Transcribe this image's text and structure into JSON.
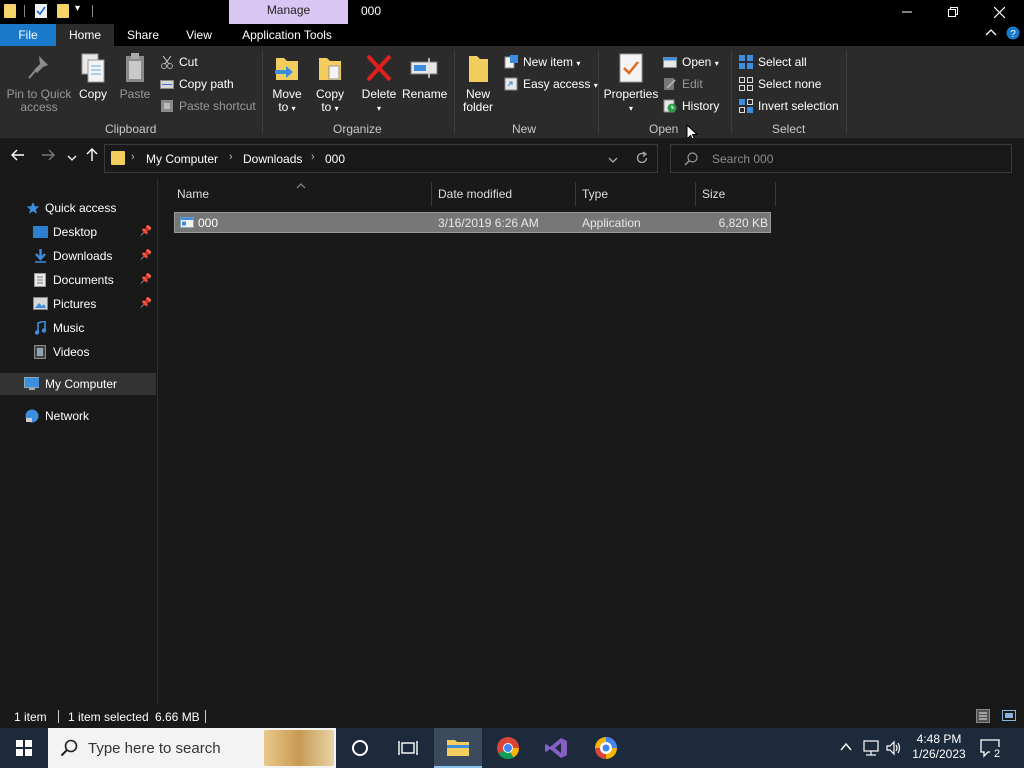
{
  "titlebar": {
    "manage_label": "Manage",
    "title": "000"
  },
  "ribbon_tabs": {
    "file": "File",
    "home": "Home",
    "share": "Share",
    "view": "View",
    "app_tools": "Application Tools"
  },
  "clipboard": {
    "pin": "Pin to Quick access",
    "copy": "Copy",
    "paste": "Paste",
    "cut": "Cut",
    "copy_path": "Copy path",
    "paste_shortcut": "Paste shortcut",
    "label": "Clipboard"
  },
  "organize": {
    "move_to": "Move to",
    "copy_to": "Copy to",
    "delete": "Delete",
    "rename": "Rename",
    "label": "Organize"
  },
  "new_group": {
    "new_folder": "New folder",
    "new_item": "New item",
    "easy_access": "Easy access",
    "label": "New"
  },
  "open_group": {
    "properties": "Properties",
    "open": "Open",
    "edit": "Edit",
    "history": "History",
    "label": "Open"
  },
  "select_group": {
    "select_all": "Select all",
    "select_none": "Select none",
    "invert": "Invert selection",
    "label": "Select"
  },
  "address": {
    "crumbs": [
      "My Computer",
      "Downloads",
      "000"
    ]
  },
  "search": {
    "placeholder": "Search 000"
  },
  "navpane": {
    "quick_access": "Quick access",
    "desktop": "Desktop",
    "downloads": "Downloads",
    "documents": "Documents",
    "pictures": "Pictures",
    "music": "Music",
    "videos": "Videos",
    "my_computer": "My Computer",
    "network": "Network"
  },
  "columns": {
    "name": "Name",
    "date_modified": "Date modified",
    "type": "Type",
    "size": "Size"
  },
  "files": [
    {
      "name": "000",
      "date_modified": "3/16/2019 6:26 AM",
      "type": "Application",
      "size": "6,820 KB"
    }
  ],
  "status": {
    "count": "1 item",
    "selected": "1 item selected",
    "size": "6.66 MB"
  },
  "taskbar": {
    "search_placeholder": "Type here to search",
    "time": "4:48 PM",
    "date": "1/26/2023",
    "notification_count": "2"
  }
}
